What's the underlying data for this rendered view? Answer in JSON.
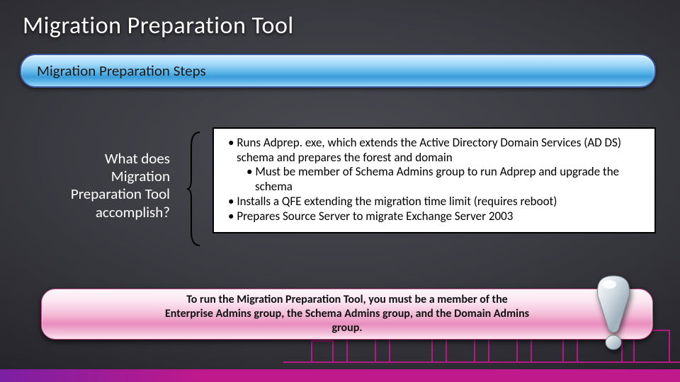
{
  "title": "Migration Preparation Tool",
  "steps_banner": "Migration Preparation Steps",
  "question": "What does Migration Preparation Tool accomplish?",
  "bullets": {
    "b1": "Runs Adprep. exe,  which extends the Active Directory Domain Services (AD DS) schema and prepares the forest and domain",
    "b1a": "Must be member of Schema Admins group to run Adprep and upgrade the schema",
    "b2": "Installs a QFE extending the migration time limit (requires reboot)",
    "b3": "Prepares Source Server to migrate Exchange Server 2003"
  },
  "note": "To run the Migration Preparation Tool, you must be a member of the Enterprise Admins group, the Schema Admins group, and the Domain Admins group.",
  "colors": {
    "accent_magenta": "#c0198c",
    "banner_blue": "#5eb6e8",
    "banner_pink": "#f3bdd8"
  }
}
